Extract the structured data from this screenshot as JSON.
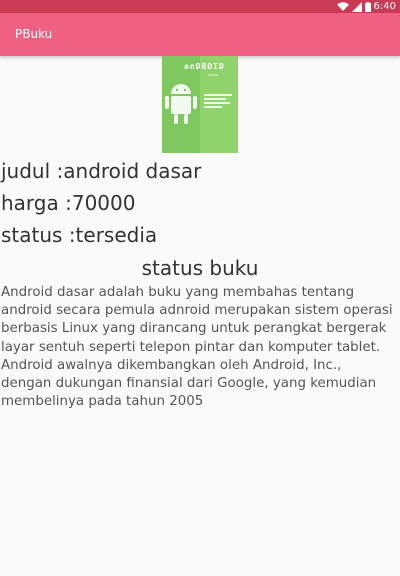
{
  "status_bar": {
    "time": "6:40"
  },
  "app_bar": {
    "title": "PBuku"
  },
  "book": {
    "cover": {
      "brand_text": "anDROID",
      "sub_text": "DASAR"
    },
    "title_line": "judul :android dasar",
    "price_line": "harga :70000",
    "status_line": "status :tersedia"
  },
  "status_section": {
    "heading": "status buku",
    "description": "Android dasar adalah buku yang membahas tentang\nandroid secara pemula adnroid merupakan sistem operasi\nberbasis Linux yang dirancang untuk perangkat bergerak\nlayar sentuh seperti telepon pintar dan komputer tablet.\nAndroid awalnya dikembangkan oleh Android, Inc.,\ndengan dukungan finansial dari Google, yang kemudian\nmembelinya pada tahun 2005"
  },
  "colors": {
    "status_bar": "#c93a55",
    "app_bar": "#f06080",
    "cover_green": "#7ec85f"
  },
  "icons": [
    "wifi-icon",
    "signal-icon",
    "battery-icon"
  ]
}
